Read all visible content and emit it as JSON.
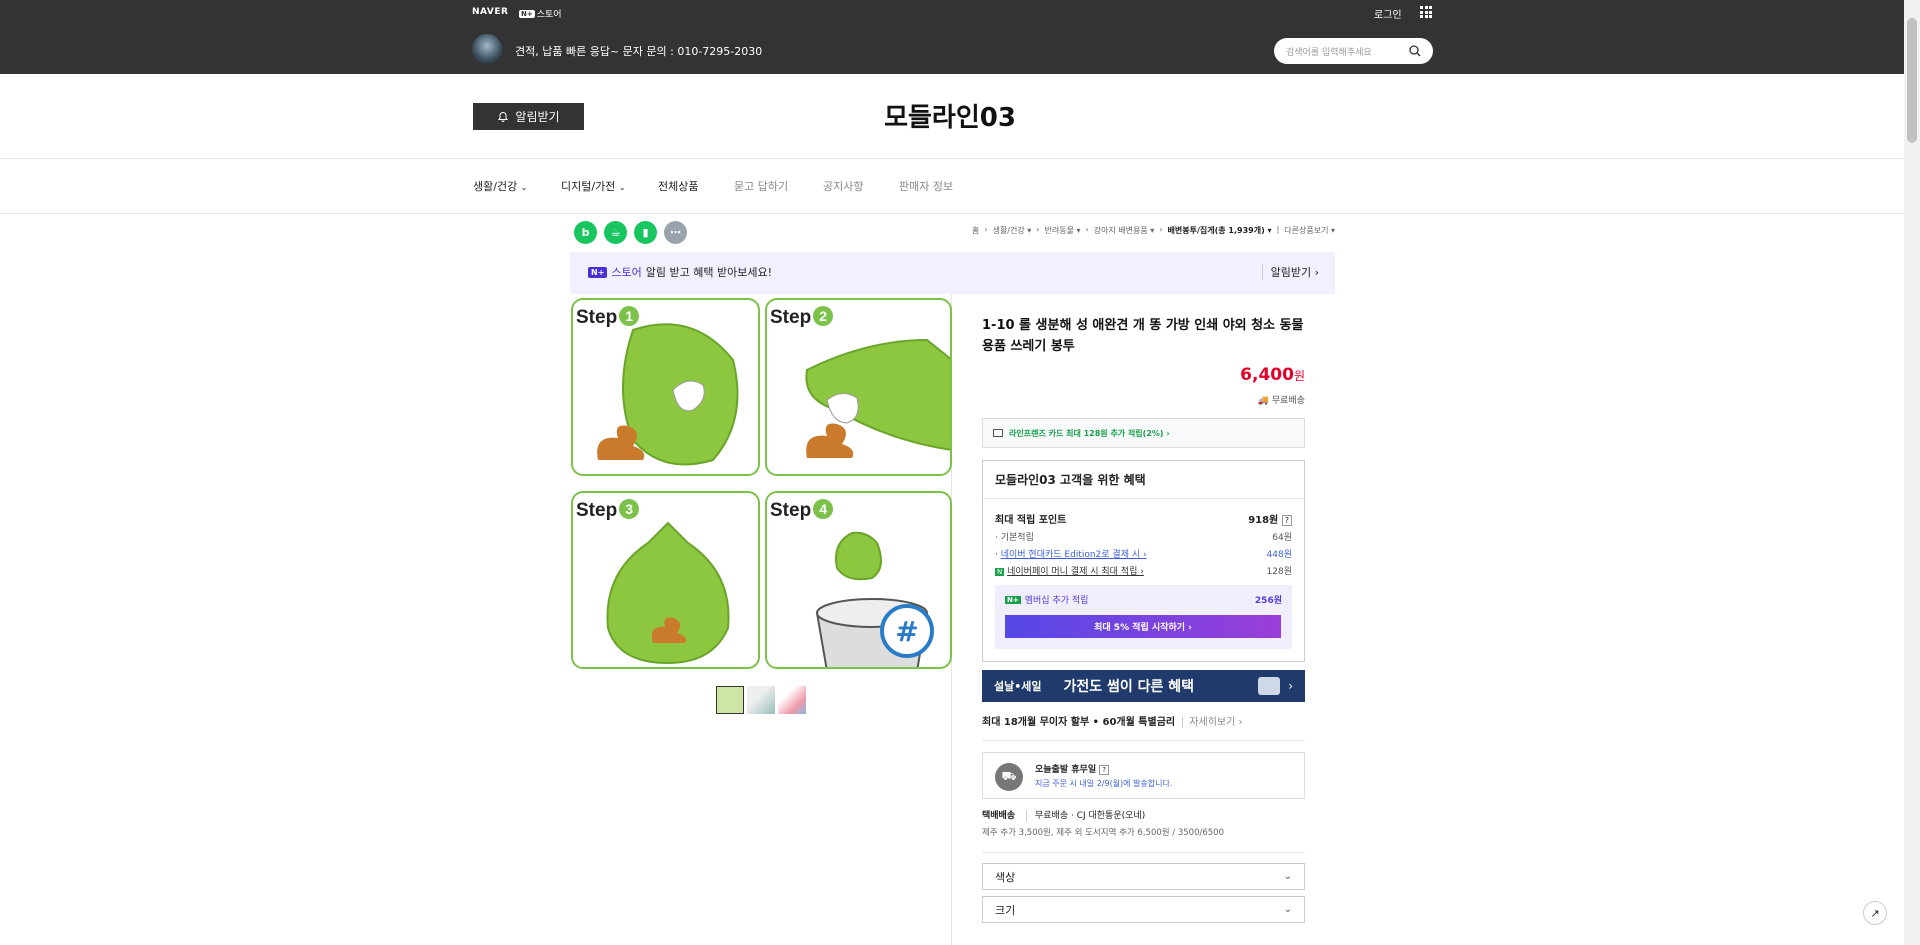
{
  "topbar": {
    "naver": "NAVER",
    "np_badge": "N+",
    "store": "스토어",
    "login": "로그인",
    "shop_notice": "견적, 납품 빠른 응답~ 문자 문의 : 010-7295-2030",
    "search_placeholder": "검색어를 입력해주세요"
  },
  "header": {
    "alarm_button": "알림받기",
    "store_name": "모들라인03"
  },
  "nav": {
    "items": [
      "생활/건강",
      "디지털/가전",
      "전체상품",
      "묻고 답하기",
      "공지사항",
      "판매자 정보"
    ]
  },
  "share_icons": [
    "bi",
    "talk",
    "bookmark",
    "more"
  ],
  "breadcrumb": {
    "items": [
      "홈",
      "생활/건강",
      "반려동물",
      "강아지 배변용품",
      "배변봉투/집게(총 1,939개)",
      "다른상품보기"
    ]
  },
  "store_banner": {
    "badge": "N+",
    "store": "스토어",
    "text": "알림 받고 혜택 받아보세요!",
    "action": "알림받기 ›"
  },
  "gallery": {
    "steps": [
      "Step",
      "Step",
      "Step",
      "Step"
    ],
    "step_numbers": [
      "1",
      "2",
      "3",
      "4"
    ]
  },
  "product": {
    "title": "1-10 롤 생분해 성 애완견 개 똥 가방 인쇄 야외 청소 동물 용품 쓰레기 봉투",
    "price": "6,400",
    "price_unit": "원",
    "shipping": "무료배송",
    "card_benefit": "라인프렌즈 카드 최대 128원 추가 적립(2%) ›"
  },
  "benefit": {
    "title": "모들라인03 고객을 위한 혜택",
    "max_points_label": "최대 적립 포인트",
    "max_points_value": "918원",
    "rows": [
      {
        "label": "기본적립",
        "value": "64원"
      },
      {
        "label": "네이버 현대카드 Edition2로 결제 시 ›",
        "value": "448원"
      },
      {
        "label": "네이버페이 머니 결제 시 최대 적립 ›",
        "value": "128원"
      }
    ],
    "membership_badge": "N+",
    "membership_label": "멤버십 추가 적립",
    "membership_value": "256원",
    "membership_button": "최대 5% 적립 시작하기 ›"
  },
  "promo": {
    "left": "설날•세일",
    "main": "가전도 썸이 다른 혜택"
  },
  "installment": {
    "text": "최대 18개월 무이자 할부 • 60개월 특별금리",
    "detail": "자세히보기 ›"
  },
  "delivery": {
    "title": "오늘출발 휴무일",
    "sub": "지금 주문 시 내일 2/9(월)에 발송합니다.",
    "type_label": "택배배송",
    "type_value": "무료배송 · CJ 대한통운(오네)",
    "extra": "제주 추가 3,500원, 제주 외 도서지역 추가 6,500원 / 3500/6500"
  },
  "options": [
    {
      "label": "색상"
    },
    {
      "label": "크기"
    }
  ],
  "colors": {
    "accent_red": "#e0002a",
    "naver_green": "#03c75a",
    "purple": "#6c4ce8",
    "dark": "#333333"
  }
}
